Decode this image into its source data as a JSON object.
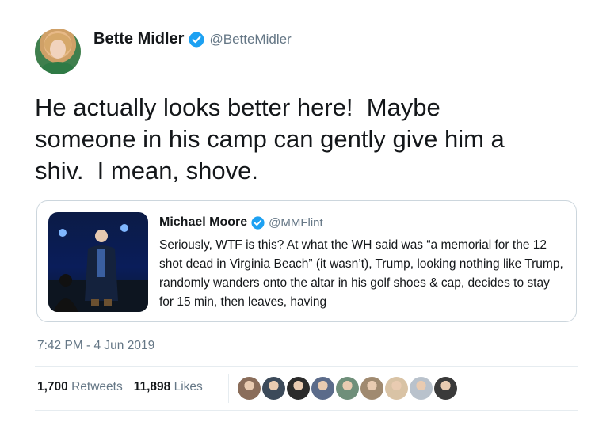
{
  "author": {
    "display_name": "Bette Midler",
    "handle": "@BetteMidler"
  },
  "tweet": {
    "text": "He actually looks better here!  Maybe\nsomeone in his camp can gently give him a\nshiv.  I mean, shove."
  },
  "quoted": {
    "display_name": "Michael Moore",
    "handle": "@MMFlint",
    "text": "Seriously, WTF is this? At what the WH said was “a memorial for the 12 shot dead in Virginia Beach” (it wasn’t), Trump, looking nothing like Trump, randomly wanders onto the altar in his golf shoes & cap, decides to stay for 15 min, then leaves, having"
  },
  "meta": {
    "timestamp": "7:42 PM - 4 Jun 2019"
  },
  "stats": {
    "retweets_count": "1,700",
    "retweets_label": "Retweets",
    "likes_count": "11,898",
    "likes_label": "Likes"
  },
  "colors": {
    "brand_blue": "#1da1f2",
    "muted_text": "#657786",
    "border": "#ccd6dd"
  },
  "likers": [
    {
      "color": "#8a6d5a"
    },
    {
      "color": "#3c4a5a"
    },
    {
      "color": "#2b2b2b"
    },
    {
      "color": "#5b6b8a"
    },
    {
      "color": "#6f8f7a"
    },
    {
      "color": "#a08a70"
    },
    {
      "color": "#d9c3a5"
    },
    {
      "color": "#b9c2cc"
    },
    {
      "color": "#3a3a3a"
    }
  ]
}
